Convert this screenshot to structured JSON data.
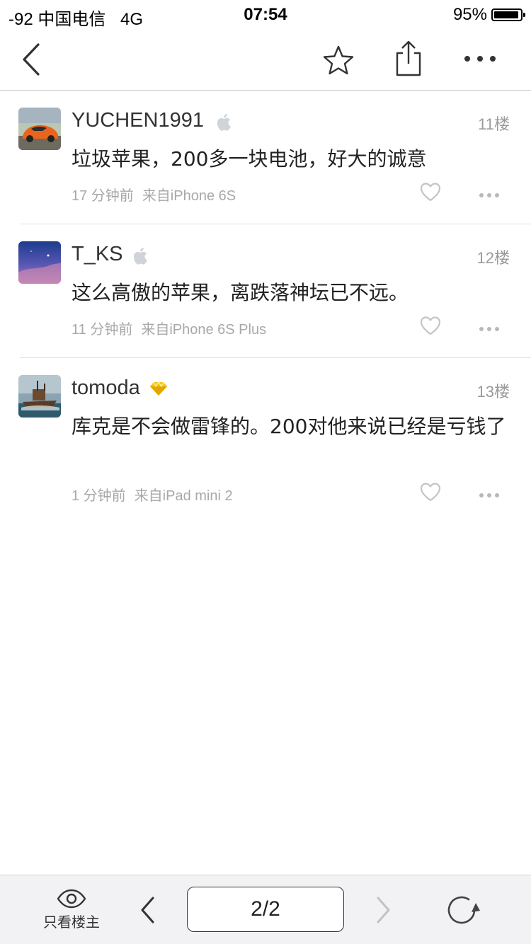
{
  "status_bar": {
    "signal": "-92",
    "carrier": "中国电信",
    "network": "4G",
    "time": "07:54",
    "battery": "95%"
  },
  "nav": {
    "icons": [
      "back-icon",
      "star-icon",
      "share-icon",
      "more-icon"
    ]
  },
  "posts": [
    {
      "username": "YUCHEN1991",
      "badge": "apple-icon",
      "floor": "11楼",
      "content": "垃圾苹果，200多一块电池，好大的诚意",
      "time": "17 分钟前",
      "source": "来自iPhone 6S"
    },
    {
      "username": "T_KS",
      "badge": "apple-icon",
      "floor": "12楼",
      "content": "这么高傲的苹果，离跌落神坛已不远。",
      "time": "11 分钟前",
      "source": "来自iPhone 6S Plus"
    },
    {
      "username": "tomoda",
      "badge": "diamond-icon",
      "floor": "13楼",
      "content": "库克是不会做雷锋的。200对他来说已经是亏钱了",
      "time": "1 分钟前",
      "source": "来自iPad mini 2"
    }
  ],
  "toolbar": {
    "only_op_label": "只看楼主",
    "page": "2/2"
  },
  "colors": {
    "text": "#222222",
    "meta": "#a8a8a8",
    "badge_gold": "#f5c518",
    "toolbar_bg": "#f2f2f4"
  }
}
